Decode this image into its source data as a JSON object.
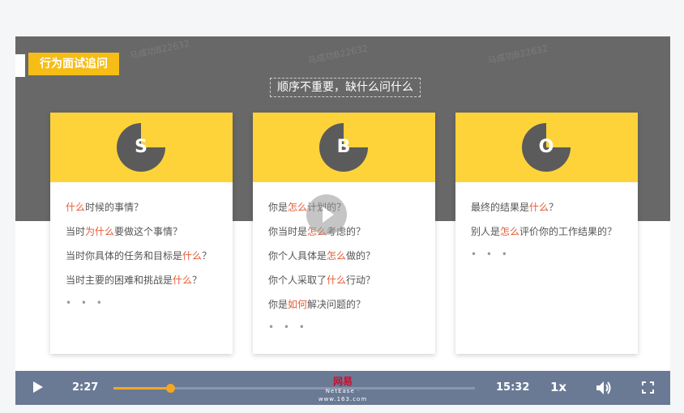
{
  "slide": {
    "title_tag": "行为面试追问",
    "subtitle": "顺序不重要，缺什么问什么",
    "watermark": "马成功B22632"
  },
  "cards": [
    {
      "letter": "S",
      "questions": [
        [
          {
            "t": "什么",
            "h": true
          },
          {
            "t": "时候的事情？",
            "h": false
          }
        ],
        [
          {
            "t": "当时",
            "h": false
          },
          {
            "t": "为什么",
            "h": true
          },
          {
            "t": "要做这个事情？",
            "h": false
          }
        ],
        [
          {
            "t": "当时你具体的任务和目标是",
            "h": false
          },
          {
            "t": "什么",
            "h": true
          },
          {
            "t": "？",
            "h": false
          }
        ],
        [
          {
            "t": "当时主要的困难和挑战是",
            "h": false
          },
          {
            "t": "什么",
            "h": true
          },
          {
            "t": "？",
            "h": false
          }
        ]
      ],
      "dots": "• • •"
    },
    {
      "letter": "B",
      "questions": [
        [
          {
            "t": "你是",
            "h": false
          },
          {
            "t": "怎么",
            "h": true
          },
          {
            "t": "计划的？",
            "h": false
          }
        ],
        [
          {
            "t": "你当时是",
            "h": false
          },
          {
            "t": "怎么",
            "h": true
          },
          {
            "t": "考虑的？",
            "h": false
          }
        ],
        [
          {
            "t": "你个人具体是",
            "h": false
          },
          {
            "t": "怎么",
            "h": true
          },
          {
            "t": "做的？",
            "h": false
          }
        ],
        [
          {
            "t": "你个人采取了",
            "h": false
          },
          {
            "t": "什么",
            "h": true
          },
          {
            "t": "行动？",
            "h": false
          }
        ],
        [
          {
            "t": "你是",
            "h": false
          },
          {
            "t": "如何",
            "h": true
          },
          {
            "t": "解决问题的？",
            "h": false
          }
        ]
      ],
      "dots": "• • •"
    },
    {
      "letter": "O",
      "questions": [
        [
          {
            "t": "最终的结果是",
            "h": false
          },
          {
            "t": "什么",
            "h": true
          },
          {
            "t": "？",
            "h": false
          }
        ],
        [
          {
            "t": "别人是",
            "h": false
          },
          {
            "t": "怎么",
            "h": true
          },
          {
            "t": "评价你的工作结果的？",
            "h": false
          }
        ]
      ],
      "dots": "• • •"
    }
  ],
  "player": {
    "current_time": "2:27",
    "duration": "15:32",
    "speed": "1x",
    "progress": 0.158,
    "logo_main": "网易",
    "logo_sub": "NetEase · www.163.com",
    "colors": {
      "accent": "#f6a623",
      "highlight": "#e45b36",
      "card_head": "#fdd339"
    }
  }
}
